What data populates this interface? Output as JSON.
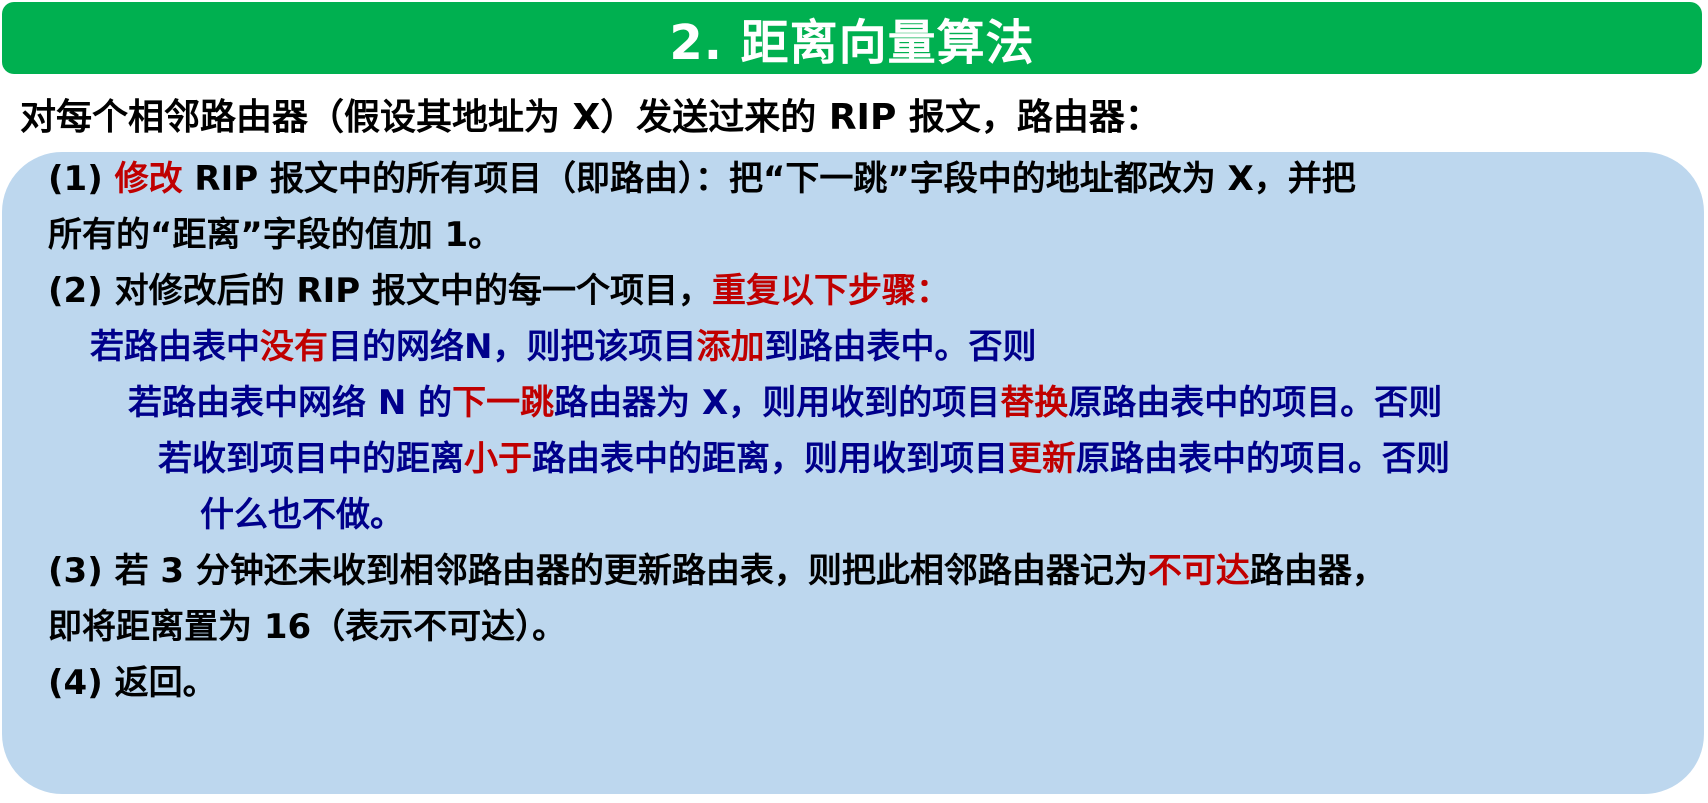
{
  "title": "2. 距离向量算法",
  "intro": "对每个相邻路由器（假设其地址为 X）发送过来的 RIP 报文，路由器：",
  "step1": {
    "prefix": "(1) ",
    "highlight": "修改",
    "rest": " RIP 报文中的所有项目（即路由）：把“下一跳”字段中的地址都改为 X，并把",
    "cont": "所有的“距离”字段的值加 1。"
  },
  "step2": {
    "text": "(2) 对修改后的 RIP 报文中的每一个项目，",
    "highlight": "重复以下步骤："
  },
  "rule_a": {
    "p1": "若路由表中",
    "h1": "没有",
    "p2": "目的网络N，则把该项目",
    "h2": "添加",
    "p3": "到路由表中。否则"
  },
  "rule_b": {
    "p1": "若路由表中网络 N 的",
    "h1": "下一跳",
    "p2": "路由器为 X，则用收到的项目",
    "h2": "替换",
    "p3": "原路由表中的项目。否则"
  },
  "rule_c": {
    "p1": "若收到项目中的距离",
    "h1": "小于",
    "p2": "路由表中的距离，则用收到项目",
    "h2": "更新",
    "p3": "原路由表中的项目。否则"
  },
  "rule_d": "什么也不做。",
  "step3": {
    "p1": "(3) 若 3 分钟还未收到相邻路由器的更新路由表，则把此相邻路由器记为",
    "h1": "不可达",
    "p2": "路由器，",
    "cont": "即将距离置为 16（表示不可达）。"
  },
  "step4": "(4) 返回。",
  "colors": {
    "title_bg": "#00b050",
    "panel_bg": "#bdd7ee",
    "rule_text": "#00008b",
    "highlight": "#c00000"
  }
}
